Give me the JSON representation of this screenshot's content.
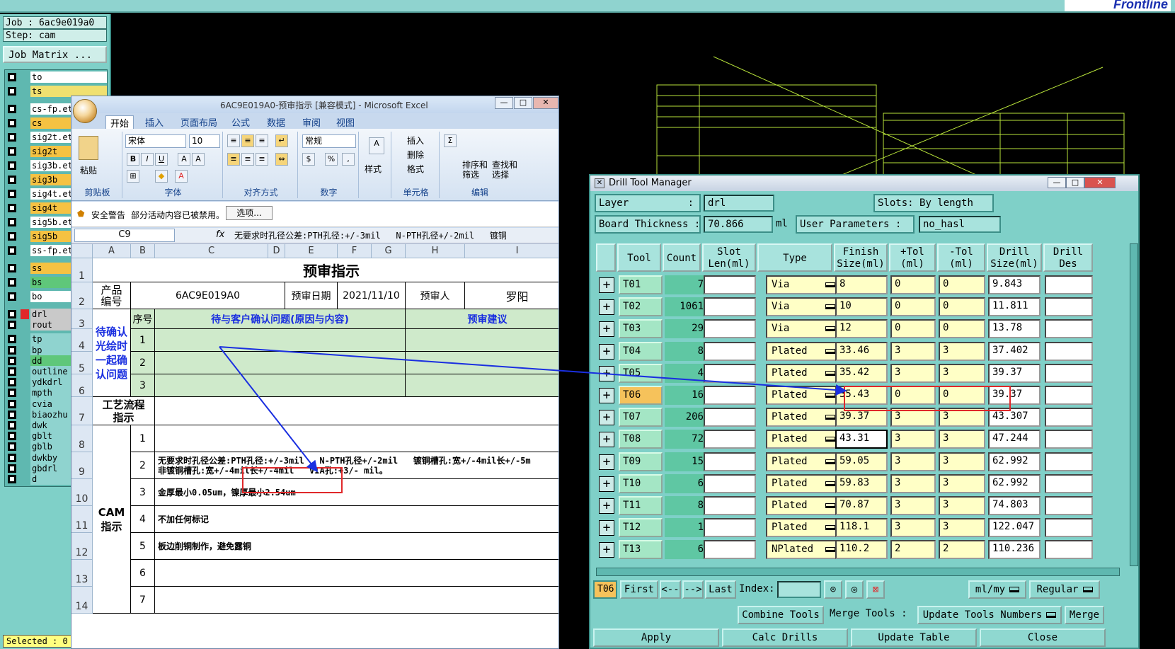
{
  "topbar": {
    "brand": "Frontline"
  },
  "left_panel": {
    "job": "Job : 6ac9e019a0",
    "step": "Step: cam",
    "job_matrix": "Job Matrix ...",
    "layers": [
      {
        "name": "to",
        "color": "#ffffff",
        "marker": ""
      },
      {
        "name": "ts",
        "color": "#f0e070",
        "marker": ""
      },
      {
        "name": "cs-fp.et",
        "color": "#ffffff",
        "marker": ""
      },
      {
        "name": "cs",
        "color": "#f5c242",
        "marker": ""
      },
      {
        "name": "sig2t.et",
        "color": "#ffffff",
        "marker": ""
      },
      {
        "name": "sig2t",
        "color": "#f5c242",
        "marker": ""
      },
      {
        "name": "sig3b.et",
        "color": "#ffffff",
        "marker": ""
      },
      {
        "name": "sig3b",
        "color": "#f5c242",
        "marker": ""
      },
      {
        "name": "sig4t.et",
        "color": "#ffffff",
        "marker": ""
      },
      {
        "name": "sig4t",
        "color": "#f5c242",
        "marker": ""
      },
      {
        "name": "sig5b.et",
        "color": "#ffffff",
        "marker": ""
      },
      {
        "name": "sig5b",
        "color": "#f5c242",
        "marker": ""
      },
      {
        "name": "ss-fp.et",
        "color": "#ffffff",
        "marker": ""
      },
      {
        "name": "ss",
        "color": "#f5c242",
        "marker": ""
      },
      {
        "name": "bs",
        "color": "#5fc77a",
        "marker": ""
      },
      {
        "name": "bo",
        "color": "#ffffff",
        "marker": ""
      },
      {
        "name": "drl",
        "color": "#c9c9c9",
        "marker": "#e0282a"
      },
      {
        "name": "rout",
        "color": "#c9c9c9",
        "marker": ""
      },
      {
        "name": "tp",
        "color": "#8fd3cf",
        "marker": ""
      },
      {
        "name": "bp",
        "color": "#8fd3cf",
        "marker": ""
      },
      {
        "name": "dd",
        "color": "#5fc77a",
        "marker": ""
      },
      {
        "name": "outline",
        "color": "#8fd3cf",
        "marker": ""
      },
      {
        "name": "ydkdrl",
        "color": "#8fd3cf",
        "marker": ""
      },
      {
        "name": "mpth",
        "color": "#8fd3cf",
        "marker": ""
      },
      {
        "name": "cvia",
        "color": "#8fd3cf",
        "marker": ""
      },
      {
        "name": "biaozhu",
        "color": "#8fd3cf",
        "marker": ""
      },
      {
        "name": "dwk",
        "color": "#8fd3cf",
        "marker": ""
      },
      {
        "name": "gblt",
        "color": "#8fd3cf",
        "marker": ""
      },
      {
        "name": "gblb",
        "color": "#8fd3cf",
        "marker": ""
      },
      {
        "name": "dwkby",
        "color": "#8fd3cf",
        "marker": ""
      },
      {
        "name": "gbdrl",
        "color": "#8fd3cf",
        "marker": ""
      },
      {
        "name": "d",
        "color": "#8fd3cf",
        "marker": ""
      }
    ],
    "selected": "Selected : 0"
  },
  "excel": {
    "title": "6AC9E019A0-预审指示 [兼容模式] - Microsoft Excel",
    "tabs": [
      "开始",
      "插入",
      "页面布局",
      "公式",
      "数据",
      "审阅",
      "视图"
    ],
    "ribbon": {
      "paste": "粘贴",
      "clipboard": "剪贴板",
      "font_name": "宋体",
      "font_size": "10",
      "font_group": "字体",
      "align_group": "对齐方式",
      "number_format": "常规",
      "number_group": "数字",
      "style": "样式",
      "insert": "插入",
      "delete": "删除",
      "format": "格式",
      "cells_group": "单元格",
      "sort_filter": "排序和\n筛选",
      "find_select": "查找和\n选择",
      "edit_group": "编辑"
    },
    "security": {
      "warning": "安全警告",
      "message": "部分活动内容已被禁用。",
      "options": "选项..."
    },
    "name_box": "C9",
    "formula": "无要求时孔径公差:PTH孔径:+/-3mil   N-PTH孔径+/-2mil   镀铜",
    "columns": [
      "A",
      "B",
      "C",
      "D",
      "E",
      "F",
      "G",
      "H",
      "I"
    ],
    "rows": [
      "1",
      "2",
      "3",
      "4",
      "5",
      "6",
      "7",
      "8",
      "9",
      "10",
      "11",
      "12",
      "13",
      "14"
    ],
    "sheet": {
      "title": "预审指示",
      "product_label": "产品\n编号",
      "product_no": "6AC9E019A0",
      "review_date_label": "预审日期",
      "review_date": "2021/11/10",
      "reviewer_label": "预审人",
      "reviewer": "罗阳",
      "seq_label": "序号",
      "issue_header": "待与客户确认问题(原因与内容)",
      "suggest_header": "预审建议",
      "confirm_label": "待确认\n光绘时\n一起确\n认问题",
      "seq": [
        "1",
        "2",
        "3"
      ],
      "process_label": "工艺流程\n指示",
      "cam_label": "CAM\n指示",
      "cam_seq": [
        "1",
        "2",
        "3",
        "4",
        "5",
        "6",
        "7"
      ],
      "cam_notes": [
        "",
        "无要求时孔径公差:PTH孔径:+/-3mil   N-PTH孔径+/-2mil   镀铜槽孔:宽+/-4mil长+/-5m\n非镀铜槽孔:宽+/-4mil长+/-4mil   VIA孔:+3/- mil。",
        "金厚最小0.05um，镍厚最小2.54um",
        "不加任何标记",
        "板边削铜制作，避免露铜",
        "",
        ""
      ]
    }
  },
  "dtm": {
    "title": "Drill Tool Manager",
    "layer_label": "Layer",
    "layer_value": "drl",
    "slots_label": "Slots:",
    "slots_value": "By length",
    "board_thickness_label": "Board Thickness :",
    "board_thickness_value": "70.866",
    "board_thickness_unit": "ml",
    "user_params_label": "User Parameters :",
    "user_params_value": "no_hasl",
    "columns": [
      "Tool",
      "Count",
      "Slot\nLen(ml)",
      "Type",
      "Finish\nSize(ml)",
      "+Tol\n(ml)",
      "-Tol\n(ml)",
      "Drill\nSize(ml)",
      "Drill\nDes"
    ],
    "rows": [
      {
        "tool": "T01",
        "count": "7",
        "type": "Via",
        "finish": "8",
        "ptol": "0",
        "ntol": "0",
        "drill": "9.843"
      },
      {
        "tool": "T02",
        "count": "1061",
        "type": "Via",
        "finish": "10",
        "ptol": "0",
        "ntol": "0",
        "drill": "11.811"
      },
      {
        "tool": "T03",
        "count": "29",
        "type": "Via",
        "finish": "12",
        "ptol": "0",
        "ntol": "0",
        "drill": "13.78"
      },
      {
        "tool": "T04",
        "count": "8",
        "type": "Plated",
        "finish": "33.46",
        "ptol": "3",
        "ntol": "3",
        "drill": "37.402"
      },
      {
        "tool": "T05",
        "count": "4",
        "type": "Plated",
        "finish": "35.42",
        "ptol": "3",
        "ntol": "3",
        "drill": "39.37"
      },
      {
        "tool": "T06",
        "count": "16",
        "type": "Plated",
        "finish": "35.43",
        "ptol": "0",
        "ntol": "0",
        "drill": "39.37"
      },
      {
        "tool": "T07",
        "count": "206",
        "type": "Plated",
        "finish": "39.37",
        "ptol": "3",
        "ntol": "3",
        "drill": "43.307"
      },
      {
        "tool": "T08",
        "count": "72",
        "type": "Plated",
        "finish": "43.31",
        "ptol": "3",
        "ntol": "3",
        "drill": "47.244"
      },
      {
        "tool": "T09",
        "count": "15",
        "type": "Plated",
        "finish": "59.05",
        "ptol": "3",
        "ntol": "3",
        "drill": "62.992"
      },
      {
        "tool": "T10",
        "count": "6",
        "type": "Plated",
        "finish": "59.83",
        "ptol": "3",
        "ntol": "3",
        "drill": "62.992"
      },
      {
        "tool": "T11",
        "count": "8",
        "type": "Plated",
        "finish": "70.87",
        "ptol": "3",
        "ntol": "3",
        "drill": "74.803"
      },
      {
        "tool": "T12",
        "count": "1",
        "type": "Plated",
        "finish": "118.1",
        "ptol": "3",
        "ntol": "3",
        "drill": "122.047"
      },
      {
        "tool": "T13",
        "count": "6",
        "type": "NPlated",
        "finish": "110.2",
        "ptol": "2",
        "ntol": "2",
        "drill": "110.236"
      }
    ],
    "current_tool": "T06",
    "nav": {
      "first": "First",
      "prev": "<--",
      "next": "-->",
      "last": "Last",
      "index": "Index:",
      "units": "ml/my",
      "mode": "Regular"
    },
    "actions": {
      "combine": "Combine Tools",
      "merge_label": "Merge Tools :",
      "update_numbers": "Update Tools Numbers",
      "merge": "Merge"
    },
    "bottom": {
      "apply": "Apply",
      "calc": "Calc Drills",
      "update_table": "Update Table",
      "close": "Close"
    }
  }
}
